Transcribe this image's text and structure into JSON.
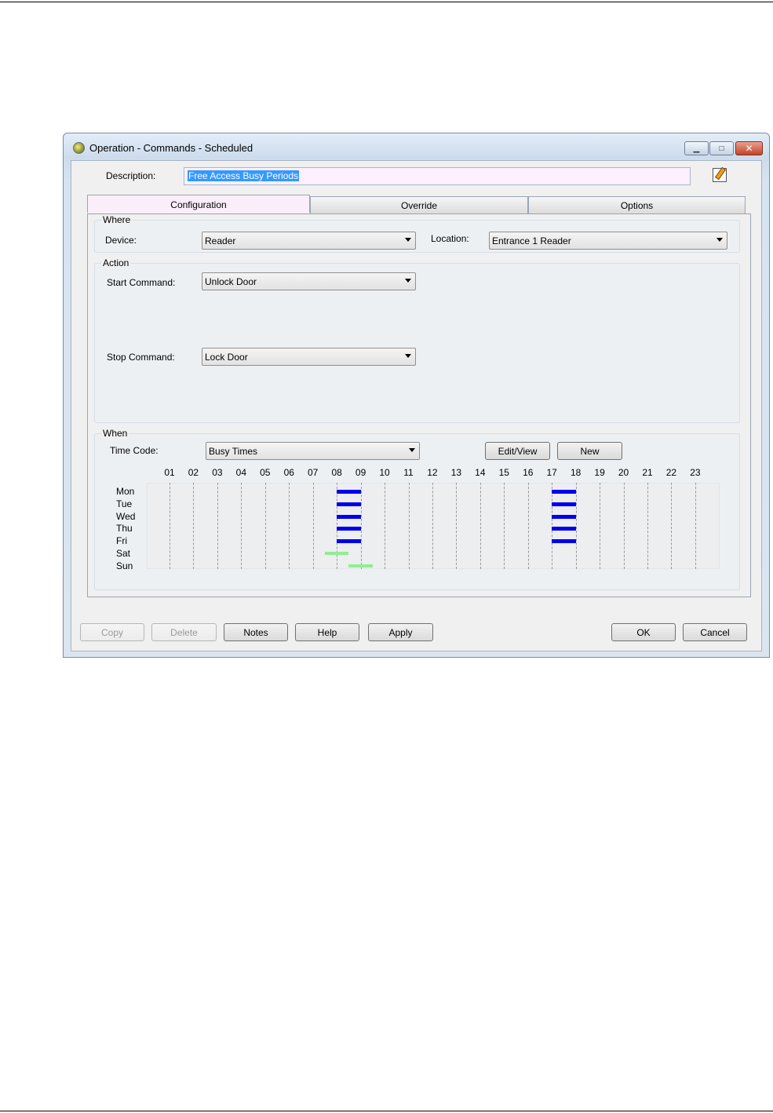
{
  "window": {
    "title": "Operation - Commands - Scheduled"
  },
  "description": {
    "label": "Description:",
    "value": "Free Access Busy Periods"
  },
  "tabs": [
    {
      "label": "Configuration",
      "active": true
    },
    {
      "label": "Override",
      "active": false
    },
    {
      "label": "Options",
      "active": false
    }
  ],
  "where": {
    "title": "Where",
    "device_label": "Device:",
    "device_value": "Reader",
    "location_label": "Location:",
    "location_value": "Entrance 1 Reader"
  },
  "action": {
    "title": "Action",
    "start_label": "Start Command:",
    "start_value": "Unlock Door",
    "stop_label": "Stop Command:",
    "stop_value": "Lock Door"
  },
  "when": {
    "title": "When",
    "timecode_label": "Time Code:",
    "timecode_value": "Busy Times",
    "edit_view_label": "Edit/View",
    "new_label": "New",
    "hours": [
      "01",
      "02",
      "03",
      "04",
      "05",
      "06",
      "07",
      "08",
      "09",
      "10",
      "11",
      "12",
      "13",
      "14",
      "15",
      "16",
      "17",
      "18",
      "19",
      "20",
      "21",
      "22",
      "23"
    ],
    "days": [
      "Mon",
      "Tue",
      "Wed",
      "Thu",
      "Fri",
      "Sat",
      "Sun"
    ],
    "colors": {
      "weekday": "#0000ee",
      "weekend": "#90ee90"
    },
    "periods": [
      {
        "day": "Mon",
        "start": 8,
        "end": 9
      },
      {
        "day": "Mon",
        "start": 17,
        "end": 18
      },
      {
        "day": "Tue",
        "start": 8,
        "end": 9
      },
      {
        "day": "Tue",
        "start": 17,
        "end": 18
      },
      {
        "day": "Wed",
        "start": 8,
        "end": 9
      },
      {
        "day": "Wed",
        "start": 17,
        "end": 18
      },
      {
        "day": "Thu",
        "start": 8,
        "end": 9
      },
      {
        "day": "Thu",
        "start": 17,
        "end": 18
      },
      {
        "day": "Fri",
        "start": 8,
        "end": 9
      },
      {
        "day": "Fri",
        "start": 17,
        "end": 18
      },
      {
        "day": "Sat",
        "start": 7.5,
        "end": 8.5
      },
      {
        "day": "Sun",
        "start": 8.5,
        "end": 9.5
      }
    ]
  },
  "buttons": {
    "copy": "Copy",
    "delete": "Delete",
    "notes": "Notes",
    "help": "Help",
    "apply": "Apply",
    "ok": "OK",
    "cancel": "Cancel"
  }
}
